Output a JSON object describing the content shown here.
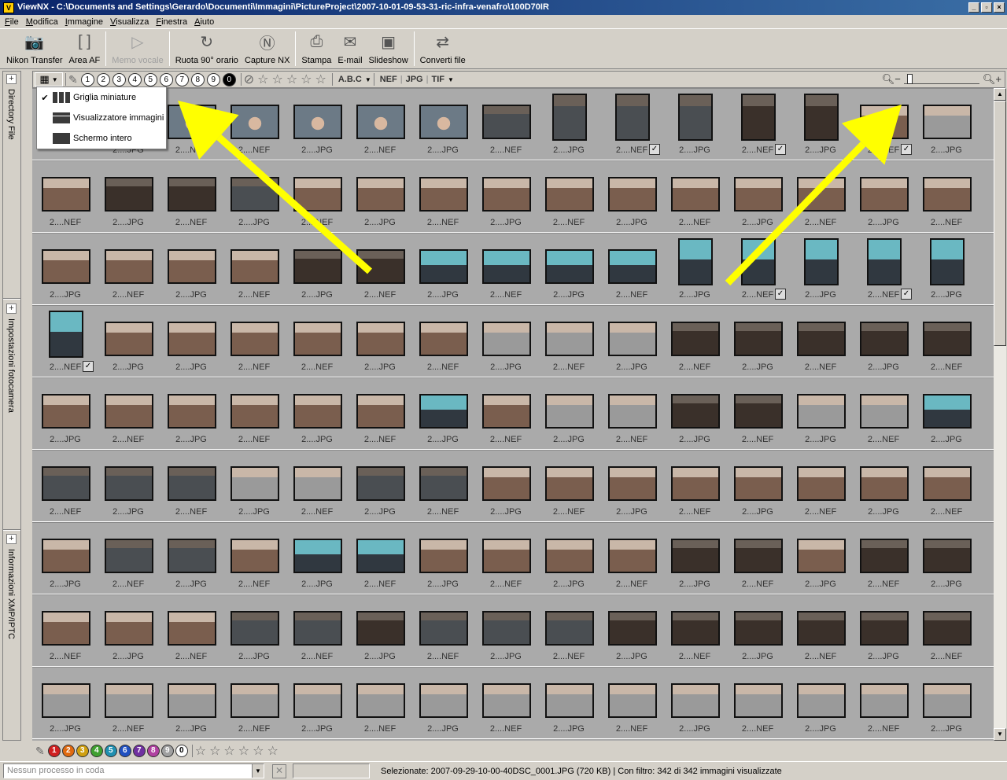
{
  "window": {
    "title": "ViewNX - C:\\Documents and Settings\\Gerardo\\Documenti\\Immagini\\PictureProject\\2007-10-01-09-53-31-ric-infra-venafro\\100D70IR",
    "minimize": "_",
    "maximize": "▫",
    "close": "×"
  },
  "menu": [
    "File",
    "Modifica",
    "Immagine",
    "Visualizza",
    "Finestra",
    "Aiuto"
  ],
  "toolbar": {
    "items": [
      {
        "label": "Nikon Transfer",
        "icon": "camera-icon",
        "glyph": "📷",
        "disabled": false
      },
      {
        "label": "Area AF",
        "icon": "af-bracket-icon",
        "glyph": "[ ]",
        "disabled": false
      },
      {
        "label": "Memo vocale",
        "icon": "voice-memo-icon",
        "glyph": "▷",
        "disabled": true
      },
      {
        "label": "Ruota 90° orario",
        "icon": "rotate-icon",
        "glyph": "↻",
        "disabled": false
      },
      {
        "label": "Capture NX",
        "icon": "capture-nx-icon",
        "glyph": "Ⓝ",
        "disabled": false
      },
      {
        "label": "Stampa",
        "icon": "print-icon",
        "glyph": "⎙",
        "disabled": false
      },
      {
        "label": "E-mail",
        "icon": "email-icon",
        "glyph": "✉",
        "disabled": false
      },
      {
        "label": "Slideshow",
        "icon": "slideshow-icon",
        "glyph": "▣",
        "disabled": false
      },
      {
        "label": "Converti file",
        "icon": "convert-icon",
        "glyph": "⇄",
        "disabled": false
      }
    ]
  },
  "side_panel": {
    "sections": [
      "Directory File",
      "Impostazioni fotocamera",
      "Informazioni XMP/IPTC"
    ]
  },
  "filter_bar": {
    "ratings": [
      "1",
      "2",
      "3",
      "4",
      "5",
      "6",
      "7",
      "8",
      "9",
      "0"
    ],
    "text_filter": "A.B.C",
    "format_filters": [
      "NEF",
      "JPG",
      "TIF"
    ],
    "zoom_level": 0.05
  },
  "view_menu": {
    "items": [
      {
        "label": "Griglia miniature",
        "checked": true
      },
      {
        "label": "Visualizzatore immagini",
        "checked": false
      },
      {
        "label": "Schermo intero",
        "checked": false
      }
    ]
  },
  "thumbnails": {
    "rows": [
      [
        "2....JPG",
        "2....NEF",
        "2....NEF",
        "2....JPG",
        "2....NEF",
        "2....JPG",
        "2....NEF",
        "2....JPG",
        "2....NEF",
        "2....JPG",
        "2....NEF",
        "2....JPG",
        "2....NEF",
        "2....JPG"
      ],
      [
        "2....NEF",
        "2....JPG",
        "2....NEF",
        "2....JPG",
        "2....NEF",
        "2....JPG",
        "2....NEF",
        "2....JPG",
        "2....NEF",
        "2....JPG",
        "2....NEF",
        "2....JPG",
        "2....NEF",
        "2....JPG",
        "2....NEF"
      ],
      [
        "2....JPG",
        "2....NEF",
        "2....JPG",
        "2....NEF",
        "2....JPG",
        "2....NEF",
        "2....JPG",
        "2....NEF",
        "2....JPG",
        "2....NEF",
        "2....JPG",
        "2....NEF",
        "2....JPG",
        "2....NEF",
        "2....JPG"
      ],
      [
        "2....NEF",
        "2....JPG",
        "2....JPG",
        "2....NEF",
        "2....NEF",
        "2....JPG",
        "2....NEF",
        "2....JPG",
        "2....NEF",
        "2....JPG",
        "2....NEF",
        "2....JPG",
        "2....NEF",
        "2....JPG",
        "2....NEF"
      ],
      [
        "2....JPG",
        "2....NEF",
        "2....JPG",
        "2....NEF",
        "2....JPG",
        "2....NEF",
        "2....JPG",
        "2....NEF",
        "2....JPG",
        "2....NEF",
        "2....JPG",
        "2....NEF",
        "2....JPG",
        "2....NEF",
        "2....JPG"
      ],
      [
        "2....NEF",
        "2....JPG",
        "2....NEF",
        "2....JPG",
        "2....NEF",
        "2....JPG",
        "2....NEF",
        "2....JPG",
        "2....NEF",
        "2....JPG",
        "2....NEF",
        "2....JPG",
        "2....NEF",
        "2....JPG",
        "2....NEF"
      ],
      [
        "2....JPG",
        "2....NEF",
        "2....JPG",
        "2....NEF",
        "2....JPG",
        "2....NEF",
        "2....JPG",
        "2....NEF",
        "2....JPG",
        "2....NEF",
        "2....JPG",
        "2....NEF",
        "2....JPG",
        "2....NEF",
        "2....JPG"
      ],
      [
        "2....NEF",
        "2....JPG",
        "2....NEF",
        "2....JPG",
        "2....NEF",
        "2....JPG",
        "2....NEF",
        "2....JPG",
        "2....NEF",
        "2....JPG",
        "2....NEF",
        "2....JPG",
        "2....NEF",
        "2....JPG",
        "2....NEF"
      ],
      [
        "2....JPG",
        "2....NEF",
        "2....JPG",
        "2....NEF",
        "2....JPG",
        "2....NEF",
        "2....JPG",
        "2....NEF",
        "2....JPG",
        "2....NEF",
        "2....JPG",
        "2....NEF",
        "2....JPG",
        "2....NEF",
        "2....JPG"
      ]
    ],
    "colors": {
      "sepia": "#7a5e4e",
      "dark": "#3a302a",
      "cyan": "#6ab8c2",
      "grey": "#9a9a9a",
      "face": "#6c7a86",
      "bw": "#4a4e52"
    }
  },
  "label_bar": {
    "labels": [
      {
        "text": "1",
        "color": "#d02020"
      },
      {
        "text": "2",
        "color": "#e06a10"
      },
      {
        "text": "3",
        "color": "#d0a010"
      },
      {
        "text": "4",
        "color": "#40a030"
      },
      {
        "text": "5",
        "color": "#2090b0"
      },
      {
        "text": "6",
        "color": "#2050c0"
      },
      {
        "text": "7",
        "color": "#7030a0"
      },
      {
        "text": "8",
        "color": "#b040a0"
      },
      {
        "text": "9",
        "color": "#a0a0a0"
      },
      {
        "text": "0",
        "color": "#ffffff"
      }
    ]
  },
  "status": {
    "queue_placeholder": "Nessun processo in coda",
    "text": "Selezionate: 2007-09-29-10-00-40DSC_0001.JPG (720 KB) | Con filtro: 342 di 342 immagini visualizzate"
  },
  "annotation": {
    "arrow_color": "#ffff00"
  }
}
